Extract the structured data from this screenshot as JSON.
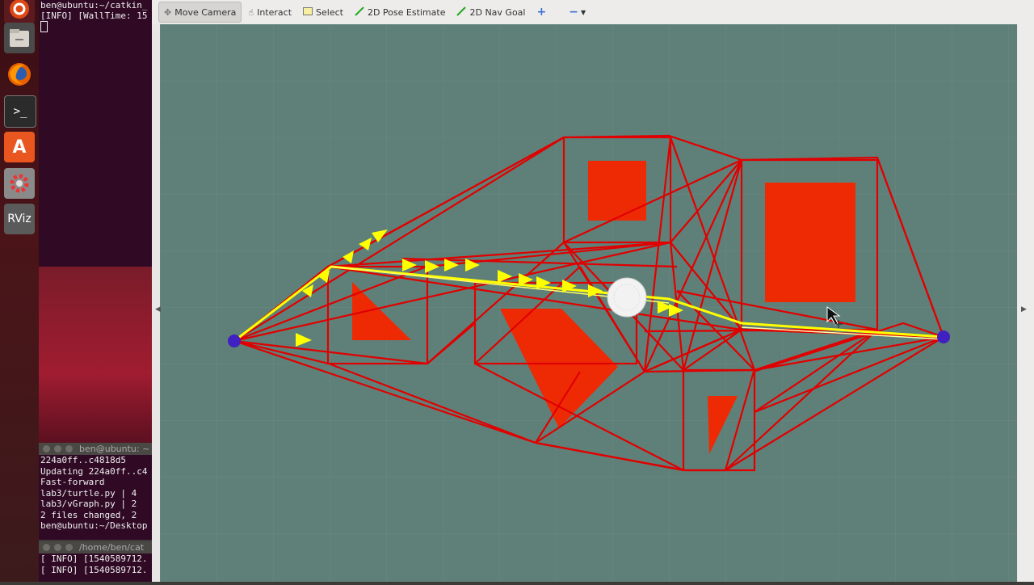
{
  "launcher": {
    "items": [
      {
        "name": "ubuntu-logo-icon"
      },
      {
        "name": "files-icon"
      },
      {
        "name": "firefox-icon"
      },
      {
        "name": "terminal-icon"
      },
      {
        "name": "software-center-icon"
      },
      {
        "name": "settings-icon"
      },
      {
        "name": "rviz-icon",
        "label": "RViz"
      }
    ]
  },
  "terminal_top": {
    "lines": [
      "ben@ubuntu:~/catkin_",
      "[INFO] [WallTime: 15"
    ]
  },
  "terminal_mid": {
    "title": "ben@ubuntu: ~",
    "lines": [
      " 224a0ff..c4818d5",
      "Updating 224a0ff..c4",
      "Fast-forward",
      " lab3/turtle.py | 4",
      " lab3/vGraph.py | 2",
      " 2 files changed, 2",
      "ben@ubuntu:~/Desktop"
    ]
  },
  "terminal_bot": {
    "title": "/home/ben/cat",
    "lines": [
      "[ INFO] [1540589712.",
      "[ INFO] [1540589712."
    ]
  },
  "toolbar": {
    "move_camera": "Move Camera",
    "interact": "Interact",
    "select": "Select",
    "pose_estimate": "2D Pose Estimate",
    "nav_goal": "2D Nav Goal"
  },
  "colors": {
    "viewport_bg": "#5f8078",
    "grid": "#6f8e86",
    "obstacle": "#ee2a05",
    "edge": "#e00000",
    "path": "#ffff00",
    "endpoint": "#4020c0"
  }
}
